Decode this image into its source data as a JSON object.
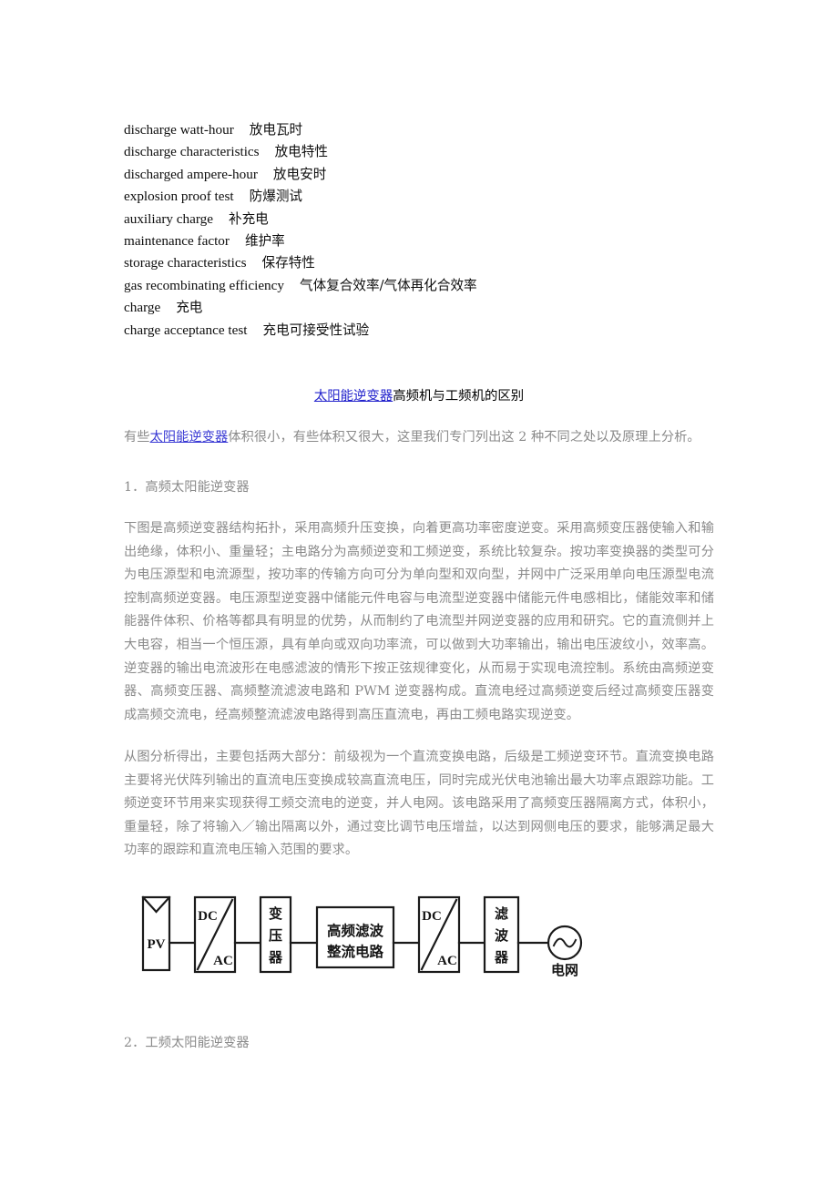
{
  "glossary": {
    "entries": [
      {
        "term": "discharge watt-hour",
        "translation": "放电瓦时"
      },
      {
        "term": "discharge characteristics",
        "translation": "放电特性"
      },
      {
        "term": "discharged ampere-hour",
        "translation": "放电安时"
      },
      {
        "term": "explosion proof test",
        "translation": "防爆测试"
      },
      {
        "term": "auxiliary charge",
        "translation": "补充电"
      },
      {
        "term": "maintenance factor",
        "translation": "维护率"
      },
      {
        "term": "storage characteristics",
        "translation": "保存特性"
      },
      {
        "term": "gas recombinating efficiency",
        "translation": "气体复合效率/气体再化合效率"
      },
      {
        "term": "charge",
        "translation": "充电"
      },
      {
        "term": "charge acceptance test",
        "translation": "充电可接受性试验"
      }
    ]
  },
  "article": {
    "title": {
      "link_text": "太阳能逆变器",
      "rest_text": "高频机与工频机的区别"
    },
    "intro": {
      "prefix": "有些",
      "link_text": "太阳能逆变器",
      "suffix": "体积很小，有些体积又很大，这里我们专门列出这 2 种不同之处以及原理上分析。"
    },
    "section_1_heading": "1．高频太阳能逆变器",
    "paragraph_1": "下图是高频逆变器结构拓扑，采用高频升压变换，向着更高功率密度逆变。采用高频变压器使输入和输出绝缘，体积小、重量轻；主电路分为高频逆变和工频逆变，系统比较复杂。按功率变换器的类型可分为电压源型和电流源型，按功率的传输方向可分为单向型和双向型，并网中广泛采用单向电压源型电流控制高频逆变器。电压源型逆变器中储能元件电容与电流型逆变器中储能元件电感相比，储能效率和储能器件体积、价格等都具有明显的优势，从而制约了电流型并网逆变器的应用和研究。它的直流侧并上大电容，相当一个恒压源，具有单向或双向功率流，可以做到大功率输出，输出电压波纹小，效率高。逆变器的输出电流波形在电感滤波的情形下按正弦规律变化，从而易于实现电流控制。系统由高频逆变器、高频变压器、高频整流滤波电路和 PWM 逆变器构成。直流电经过高频逆变后经过高频变压器变成高频交流电，经高频整流滤波电路得到高压直流电，再由工频电路实现逆变。",
    "paragraph_2": "从图分析得出，主要包括两大部分：前级视为一个直流变换电路，后级是工频逆变环节。直流变换电路主要将光伏阵列输出的直流电压变换成较高直流电压，同时完成光伏电池输出最大功率点跟踪功能。工频逆变环节用来实现获得工频交流电的逆变，并人电网。该电路采用了高频变压器隔离方式，体积小，重量轻，除了将输入／输出隔离以外，通过变比调节电压增益，以达到网侧电压的要求，能够满足最大功率的跟踪和直流电压输入范围的要求。",
    "section_2_heading": "2．工频太阳能逆变器"
  },
  "diagram": {
    "blocks": {
      "pv": "PV",
      "inverter_dc": "DC",
      "inverter_ac": "AC",
      "transformer": "变压器",
      "rectifier_line1": "高频滤波",
      "rectifier_line2": "整流电路",
      "inverter2_dc": "DC",
      "inverter2_ac": "AC",
      "filter": "滤波器",
      "grid": "电网"
    },
    "colors": {
      "stroke": "#1a1a1a",
      "text": "#151515"
    }
  }
}
